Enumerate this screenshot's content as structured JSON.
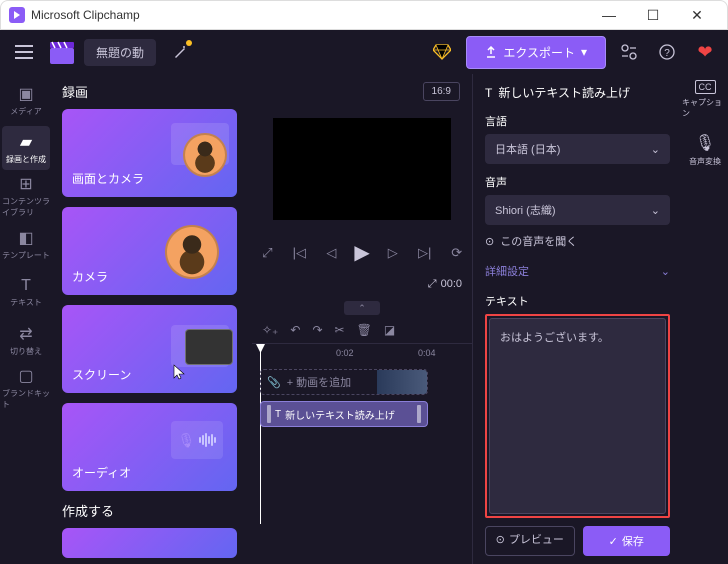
{
  "titlebar": {
    "title": "Microsoft Clipchamp"
  },
  "toolbar": {
    "project_title": "無題の動",
    "export_label": "エクスポート"
  },
  "sidebar": {
    "items": [
      {
        "label": "メディア"
      },
      {
        "label": "録画と作成"
      },
      {
        "label": "コンテンツライブラリ"
      },
      {
        "label": "テンプレート"
      },
      {
        "label": "テキスト"
      },
      {
        "label": "切り替え"
      },
      {
        "label": "ブランドキット"
      }
    ],
    "active_index": 1
  },
  "content": {
    "header": "録画",
    "create_header": "作成する",
    "cards": [
      {
        "label": "画面とカメラ"
      },
      {
        "label": "カメラ"
      },
      {
        "label": "スクリーン"
      },
      {
        "label": "オーディオ"
      }
    ]
  },
  "canvas": {
    "aspect": "16:9",
    "time_elapsed": "00:0"
  },
  "timeline": {
    "ticks": [
      "0:02",
      "0:04"
    ],
    "add_video_label": "+ 動画を追加",
    "clip_label": "新しいテキスト読み上げ"
  },
  "tts": {
    "header": "新しいテキスト読み上げ",
    "language_label": "言語",
    "language_value": "日本語 (日本)",
    "voice_label": "音声",
    "voice_value": "Shiori (志織)",
    "listen_label": "この音声を聞く",
    "advanced_label": "詳細設定",
    "text_label": "テキスト",
    "text_value": "おはようございます。",
    "preview_label": "プレビュー",
    "save_label": "保存"
  },
  "right_mini": {
    "caption_label": "キャプション",
    "audio_label": "音声変換"
  }
}
